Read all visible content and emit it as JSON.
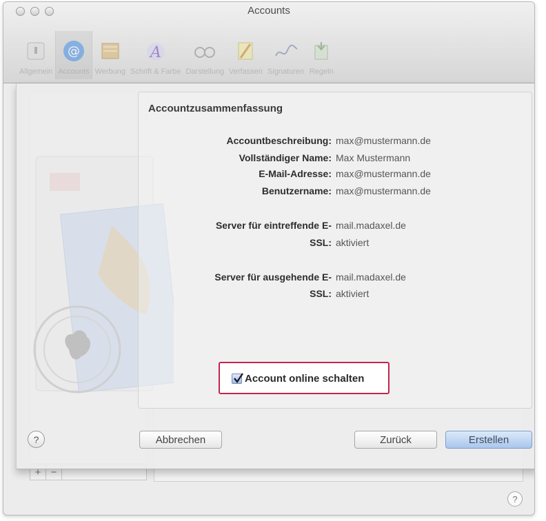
{
  "window": {
    "title": "Accounts"
  },
  "toolbar": {
    "items": [
      {
        "label": "Allgemein",
        "icon": "switch-icon"
      },
      {
        "label": "Accounts",
        "icon": "at-sign-icon"
      },
      {
        "label": "Werbung",
        "icon": "junk-mail-icon"
      },
      {
        "label": "Schrift & Farbe",
        "icon": "font-color-icon"
      },
      {
        "label": "Darstellung",
        "icon": "glasses-icon"
      },
      {
        "label": "Verfassen",
        "icon": "pencil-icon"
      },
      {
        "label": "Signaturen",
        "icon": "signature-icon"
      },
      {
        "label": "Regeln",
        "icon": "rules-icon"
      }
    ],
    "active": "Accounts"
  },
  "sheet": {
    "summary_title": "Accountzusammenfassung",
    "rows": [
      {
        "label": "Accountbeschreibung:",
        "value": "max@mustermann.de"
      },
      {
        "label": "Vollständiger Name:",
        "value": "Max Mustermann"
      },
      {
        "label": "E-Mail-Adresse:",
        "value": "max@mustermann.de"
      },
      {
        "label": "Benutzername:",
        "value": "max@mustermann.de"
      },
      {
        "label": "Server für eintreffende E-",
        "value": "mail.madaxel.de"
      },
      {
        "label": "SSL:",
        "value": "aktiviert"
      },
      {
        "label": "Server für ausgehende E-",
        "value": "mail.madaxel.de"
      },
      {
        "label": "SSL:",
        "value": "aktiviert"
      }
    ],
    "online_checkbox": {
      "label": "Account online schalten",
      "checked": true
    },
    "buttons": {
      "help": "?",
      "cancel": "Abbrechen",
      "back": "Zurück",
      "create": "Erstellen"
    }
  },
  "background": {
    "add_button": "+",
    "remove_button": "−",
    "help": "?"
  },
  "colors": {
    "highlight_border": "#c6234e",
    "default_button": "#a9c6ec"
  }
}
